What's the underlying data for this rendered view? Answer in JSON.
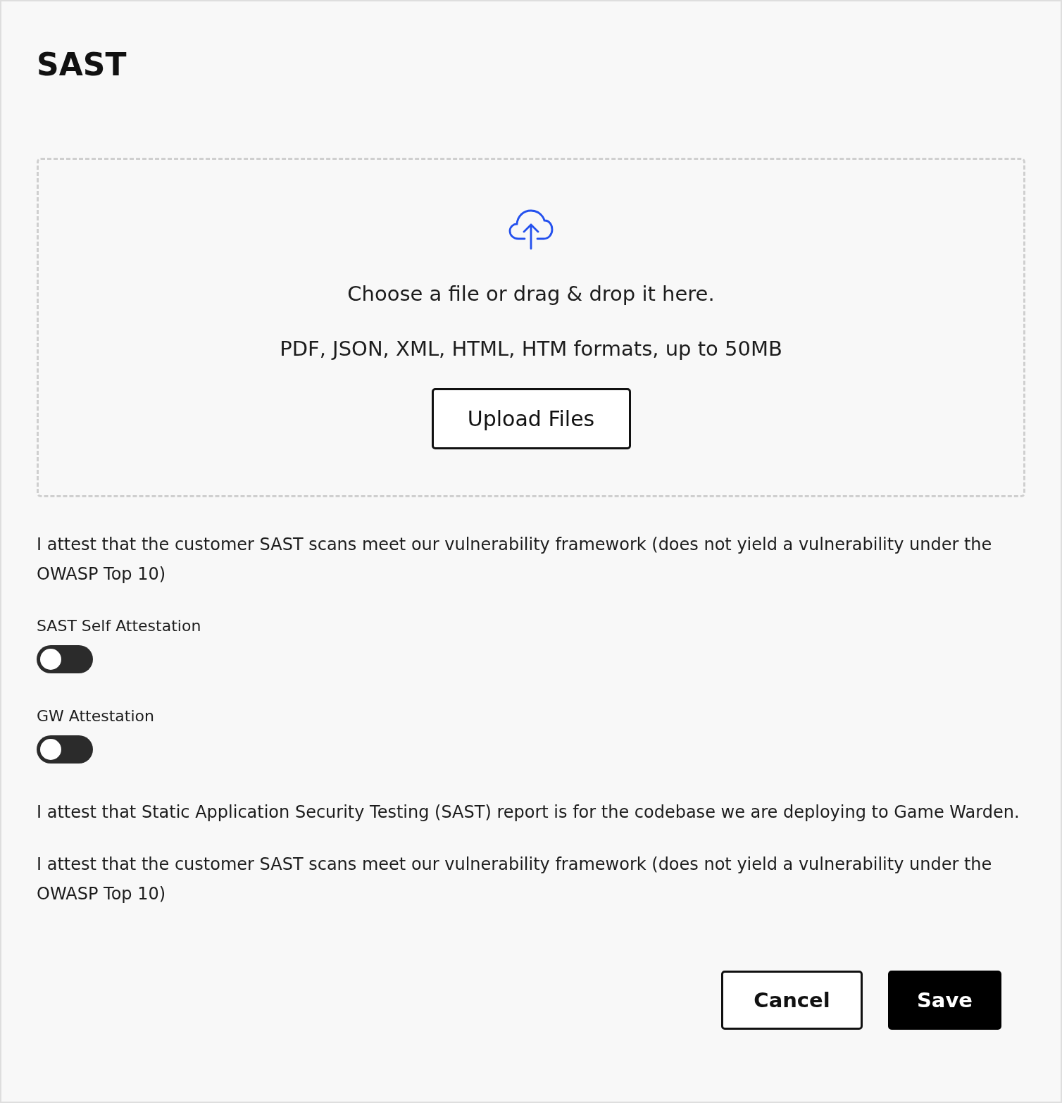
{
  "title": "SAST",
  "upload": {
    "prompt": "Choose a file or drag & drop it here.",
    "formats": "PDF, JSON, XML, HTML, HTM formats, up to 50MB",
    "button": "Upload Files"
  },
  "intro": "I attest that the customer SAST scans meet our vulnerability framework (does not yield a vulnerability under the OWASP Top 10)",
  "toggles": [
    {
      "label": "SAST Self Attestation",
      "on": false
    },
    {
      "label": "GW Attestation",
      "on": false
    }
  ],
  "statements": [
    "I attest that Static Application Security Testing (SAST) report is for the codebase we are deploying to Game Warden.",
    "I attest that the customer SAST scans meet our vulnerability framework (does not yield a vulnerability under the OWASP Top 10)"
  ],
  "actions": [
    {
      "label": "Cancel",
      "kind": "secondary"
    },
    {
      "label": "Save",
      "kind": "primary"
    }
  ]
}
